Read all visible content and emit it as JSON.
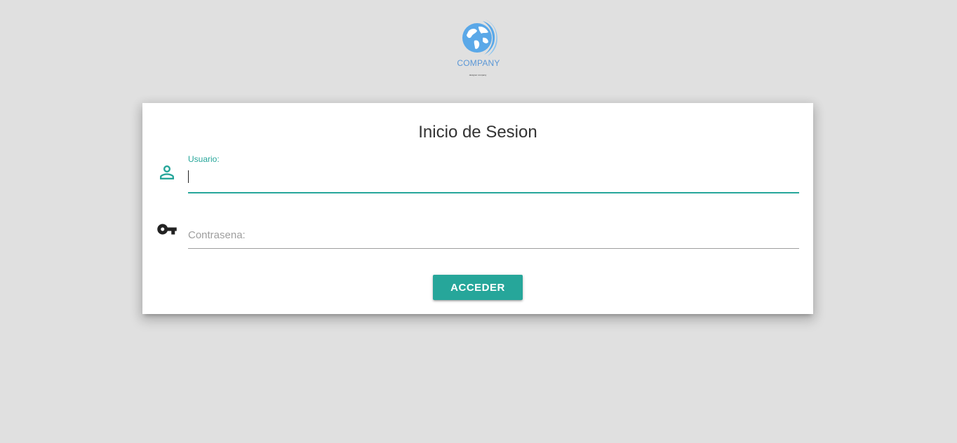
{
  "logo": {
    "name": "COMPANY",
    "tagline": "designer company",
    "brand_color": "#5b97d6"
  },
  "login": {
    "title": "Inicio de Sesion",
    "username": {
      "label": "Usuario:",
      "value": "",
      "icon": "user-icon"
    },
    "password": {
      "placeholder": "Contrasena:",
      "value": "",
      "icon": "key-icon"
    },
    "submit_label": "ACCEDER"
  },
  "colors": {
    "accent": "#26a69a",
    "background": "#e0e0e0",
    "card": "#ffffff"
  }
}
